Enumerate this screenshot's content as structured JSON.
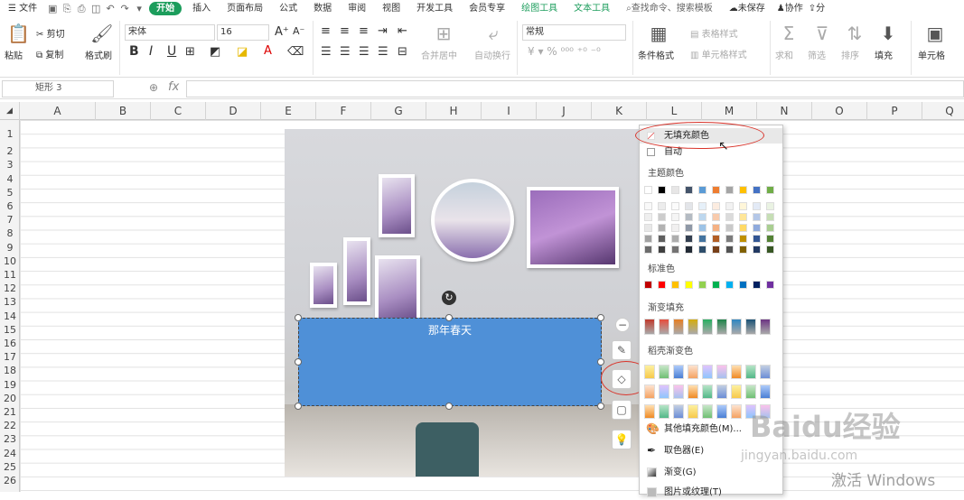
{
  "menubar": {
    "file": "文件",
    "tabs": [
      "开始",
      "插入",
      "页面布局",
      "公式",
      "数据",
      "审阅",
      "视图",
      "开发工具",
      "会员专享",
      "绘图工具",
      "文本工具"
    ],
    "search": "查找命令、搜索模板",
    "unsaved": "未保存",
    "collab": "协作",
    "share": "分"
  },
  "ribbon": {
    "paste": "粘贴",
    "cut": "剪切",
    "copy": "复制",
    "format_painter": "格式刷",
    "font_name": "宋体",
    "font_size": "16",
    "bold": "B",
    "italic": "I",
    "underline": "U",
    "merge_center": "合并居中",
    "auto_wrap": "自动换行",
    "number_format": "常规",
    "table_style": "表格样式",
    "cell_style": "单元格样式",
    "cond_format": "条件格式",
    "sum": "求和",
    "filter": "筛选",
    "sort": "排序",
    "fill": "填充",
    "cells": "单元格"
  },
  "formula_bar": {
    "name_box": "矩形 3",
    "fx": "fx"
  },
  "columns": [
    "A",
    "B",
    "C",
    "D",
    "E",
    "F",
    "G",
    "H",
    "I",
    "J",
    "K",
    "L",
    "M",
    "N",
    "O",
    "P",
    "Q"
  ],
  "rows": [
    "1",
    "2",
    "3",
    "4",
    "5",
    "6",
    "7",
    "8",
    "9",
    "10",
    "11",
    "12",
    "13",
    "14",
    "15",
    "16",
    "17",
    "18",
    "19",
    "20",
    "21",
    "22",
    "23",
    "24",
    "25",
    "26"
  ],
  "shape": {
    "text": "那年春天",
    "color": "#4f90d7"
  },
  "fill_menu": {
    "no_fill": "无填充颜色",
    "auto": "自动",
    "theme_colors": "主题颜色",
    "standard_colors": "标准色",
    "gradient_fill": "渐变填充",
    "daoke_gradient": "稻壳渐变色",
    "more_colors": "其他填充颜色(M)...",
    "eyedropper": "取色器(E)",
    "gradient": "渐变(G)",
    "picture_texture": "图片或纹理(T)",
    "theme_top": [
      "#ffffff",
      "#000000",
      "#e7e6e6",
      "#44546a",
      "#5b9bd5",
      "#ed7d31",
      "#a5a5a5",
      "#ffc000",
      "#4472c4",
      "#70ad47"
    ],
    "standard": [
      "#c00000",
      "#ff0000",
      "#ffc000",
      "#ffff00",
      "#92d050",
      "#00b050",
      "#00b0f0",
      "#0070c0",
      "#002060",
      "#7030a0"
    ],
    "gradients": [
      "#c0392b",
      "#e74c3c",
      "#e67e22",
      "#d4ac0d",
      "#27ae60",
      "#1e8449",
      "#2e86c1",
      "#1a5276",
      "#6c3483"
    ]
  },
  "watermark": {
    "baidu": "Baidu经验",
    "url": "jingyan.baidu.com",
    "activate": "激活 Windows"
  }
}
